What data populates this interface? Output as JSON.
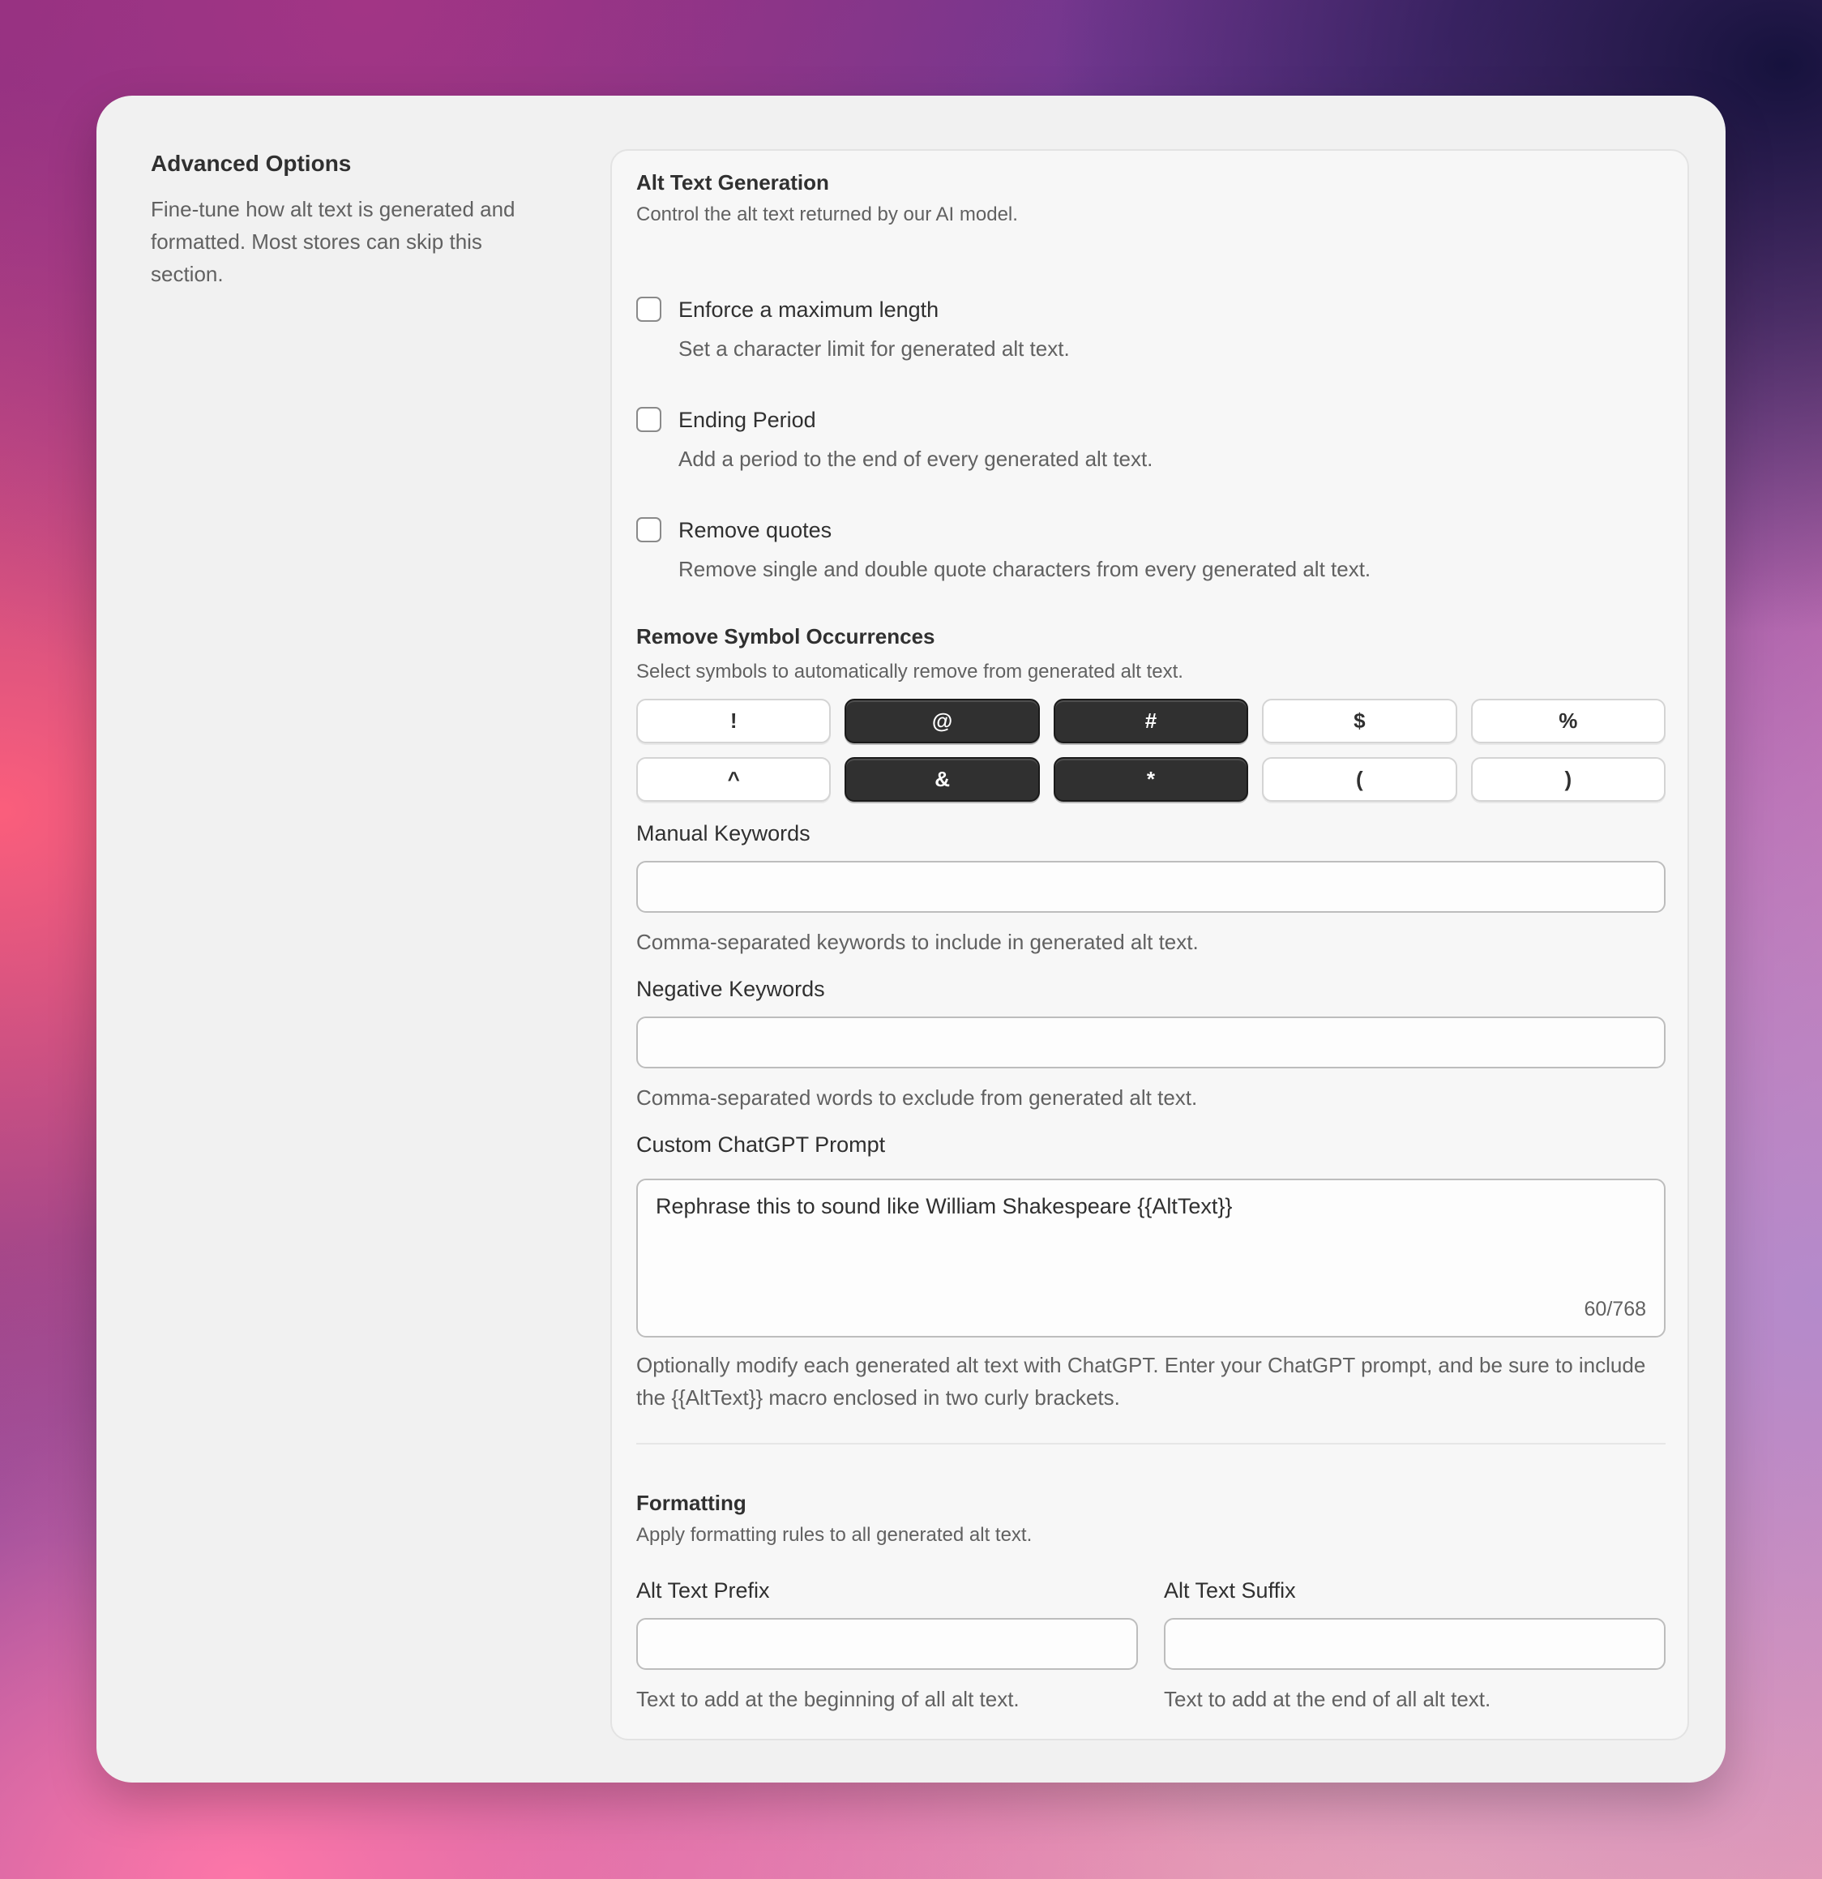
{
  "sidebar": {
    "title": "Advanced Options",
    "description": "Fine-tune how alt text is generated and formatted. Most stores can skip this section."
  },
  "generation": {
    "title": "Alt Text Generation",
    "description": "Control the alt text returned by our AI model.",
    "options": [
      {
        "label": "Enforce a maximum length",
        "help": "Set a character limit for generated alt text.",
        "checked": false
      },
      {
        "label": "Ending Period",
        "help": "Add a period to the end of every generated alt text.",
        "checked": false
      },
      {
        "label": "Remove quotes",
        "help": "Remove single and double quote characters from every generated alt text.",
        "checked": false
      }
    ]
  },
  "symbols": {
    "title": "Remove Symbol Occurrences",
    "description": "Select symbols to automatically remove from generated alt text.",
    "items": [
      {
        "symbol": "!",
        "selected": false
      },
      {
        "symbol": "@",
        "selected": true
      },
      {
        "symbol": "#",
        "selected": true
      },
      {
        "symbol": "$",
        "selected": false
      },
      {
        "symbol": "%",
        "selected": false
      },
      {
        "symbol": "^",
        "selected": false
      },
      {
        "symbol": "&",
        "selected": true
      },
      {
        "symbol": "*",
        "selected": true
      },
      {
        "symbol": "(",
        "selected": false
      },
      {
        "symbol": ")",
        "selected": false
      }
    ]
  },
  "manual_keywords": {
    "label": "Manual Keywords",
    "value": "",
    "help": "Comma-separated keywords to include in generated alt text."
  },
  "negative_keywords": {
    "label": "Negative Keywords",
    "value": "",
    "help": "Comma-separated words to exclude from generated alt text."
  },
  "custom_prompt": {
    "label": "Custom ChatGPT Prompt",
    "value": "Rephrase this to sound like William Shakespeare {{AltText}}",
    "counter": "60/768",
    "help": "Optionally modify each generated alt text with ChatGPT. Enter your ChatGPT prompt, and be sure to include the {{AltText}} macro enclosed in two curly brackets."
  },
  "formatting": {
    "title": "Formatting",
    "description": "Apply formatting rules to all generated alt text.",
    "prefix": {
      "label": "Alt Text Prefix",
      "value": "",
      "help": "Text to add at the beginning of all alt text."
    },
    "suffix": {
      "label": "Alt Text Suffix",
      "value": "",
      "help": "Text to add at the end of all alt text."
    }
  }
}
